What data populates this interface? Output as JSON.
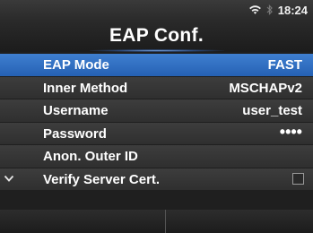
{
  "status": {
    "time": "18:24",
    "wifi_icon": "wifi-icon",
    "bluetooth_icon": "bluetooth-icon"
  },
  "header": {
    "title": "EAP Conf."
  },
  "menu": {
    "items": [
      {
        "label": "EAP Mode",
        "value": "FAST",
        "selected": true
      },
      {
        "label": "Inner Method",
        "value": "MSCHAPv2"
      },
      {
        "label": "Username",
        "value": "user_test"
      },
      {
        "label": "Password",
        "value": "••••"
      },
      {
        "label": "Anon. Outer ID",
        "value": ""
      },
      {
        "label": "Verify Server Cert.",
        "checked": false
      }
    ]
  },
  "colors": {
    "selected": "#2f6fc4",
    "row": "#353535",
    "background": "#1f1f1f"
  }
}
